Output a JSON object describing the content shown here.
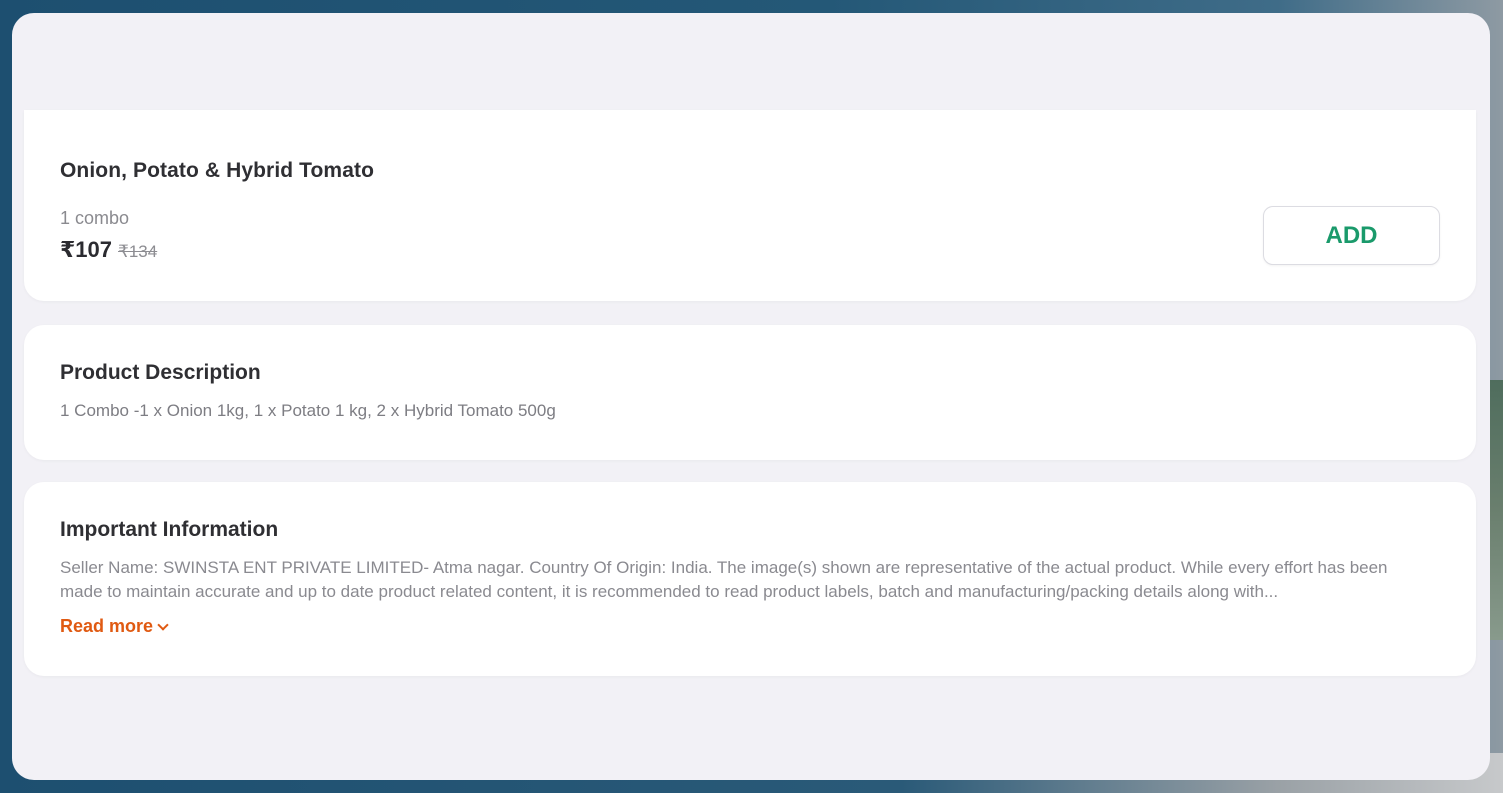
{
  "product": {
    "title": "Onion, Potato & Hybrid Tomato",
    "quantity": "1 combo",
    "price": "₹107",
    "mrp": "₹134",
    "add_label": "ADD"
  },
  "description": {
    "title": "Product Description",
    "text": "1 Combo -1 x Onion 1kg, 1 x Potato 1 kg, 2 x Hybrid Tomato 500g"
  },
  "important_info": {
    "title": "Important Information",
    "text": "Seller Name: SWINSTA ENT PRIVATE LIMITED- Atma nagar. Country Of Origin: India. The image(s) shown are representative of the actual product. While every effort has been made to maintain accurate and up to date product related content, it is recommended to read product labels, batch and manufacturing/packing details along with...",
    "read_more_label": "Read more"
  },
  "colors": {
    "accent_green": "#1a9a6b",
    "link_orange": "#e05a12",
    "modal_bg": "#f2f1f6"
  }
}
